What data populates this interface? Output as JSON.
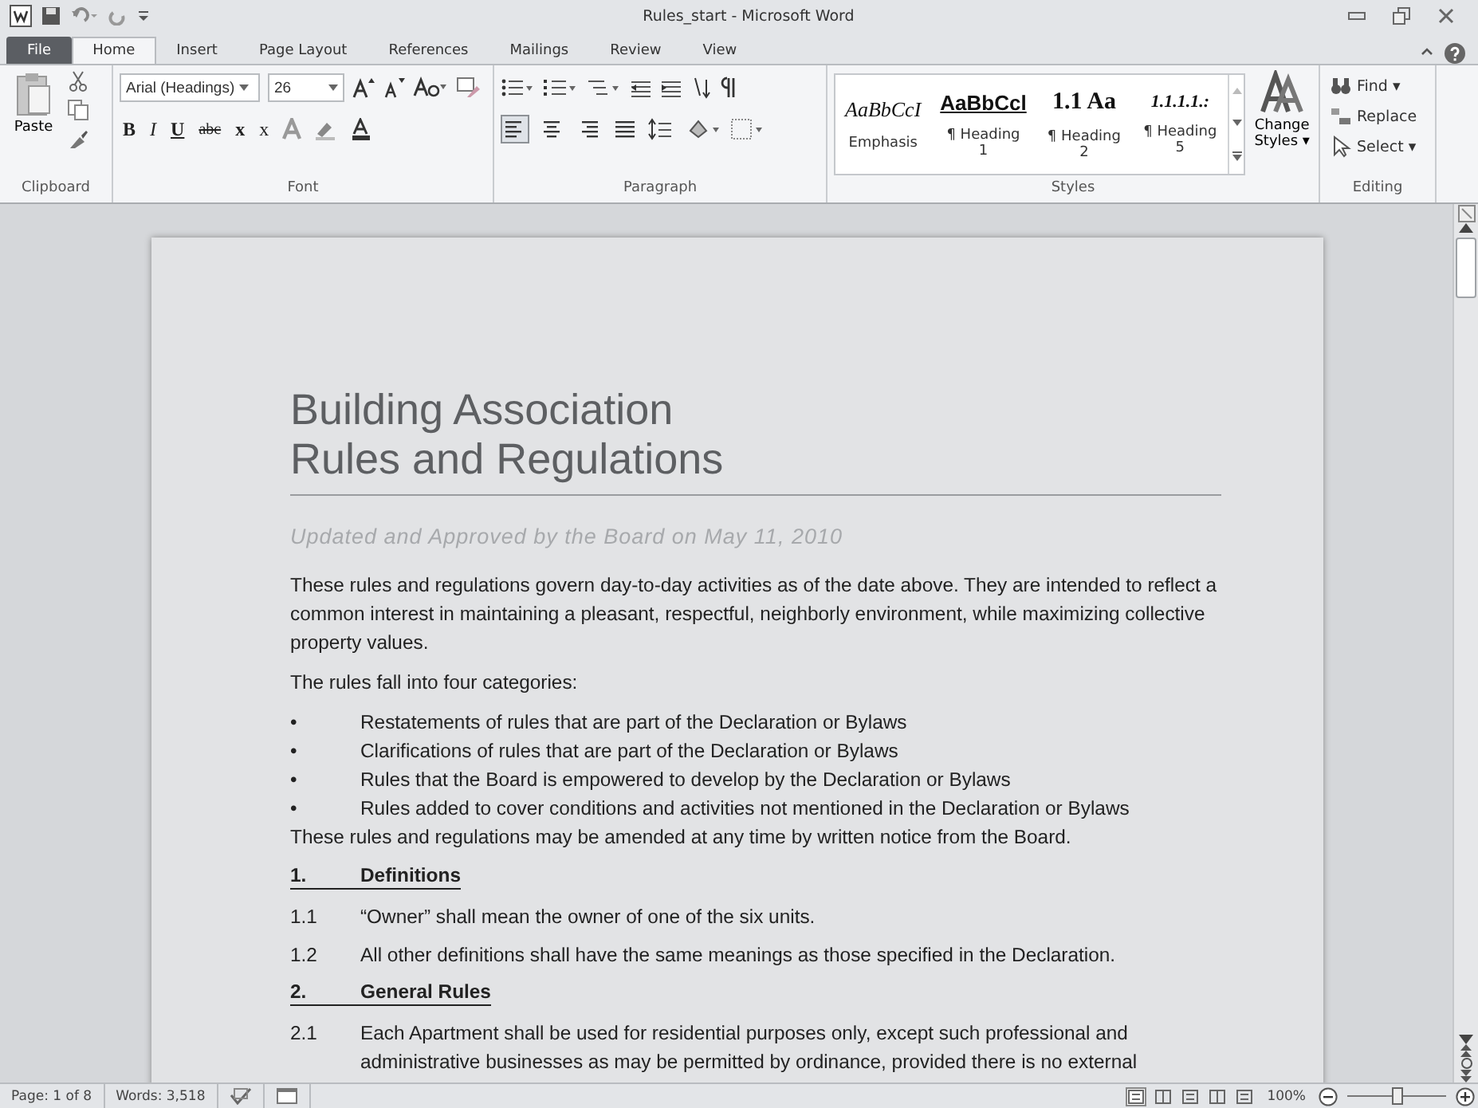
{
  "window": {
    "title": "Rules_start - Microsoft Word"
  },
  "tabs": [
    {
      "label": "File",
      "kind": "file",
      "selected": false
    },
    {
      "label": "Home",
      "kind": "tab",
      "selected": true
    },
    {
      "label": "Insert",
      "kind": "tab",
      "selected": false
    },
    {
      "label": "Page Layout",
      "kind": "tab",
      "selected": false
    },
    {
      "label": "References",
      "kind": "tab",
      "selected": false
    },
    {
      "label": "Mailings",
      "kind": "tab",
      "selected": false
    },
    {
      "label": "Review",
      "kind": "tab",
      "selected": false
    },
    {
      "label": "View",
      "kind": "tab",
      "selected": false
    }
  ],
  "ribbon": {
    "clipboard": {
      "label": "Clipboard",
      "paste": "Paste"
    },
    "font": {
      "label": "Font",
      "font_name": "Arial (Headings)",
      "font_size": "26",
      "buttons": [
        "B",
        "I",
        "U",
        "abc",
        "x",
        "x"
      ]
    },
    "paragraph": {
      "label": "Paragraph",
      "alignment": [
        {
          "selected": true
        },
        {
          "selected": false
        },
        {
          "selected": false
        },
        {
          "selected": false
        }
      ]
    },
    "styles": {
      "label": "Styles",
      "items": [
        {
          "preview": "AaBbCcI",
          "name": "Emphasis",
          "kind": "italic"
        },
        {
          "preview": "AaBbCcl",
          "name": "¶ Heading 1",
          "kind": "underlined"
        },
        {
          "preview": "1.1  Aa",
          "name": "¶ Heading 2",
          "kind": "bold"
        },
        {
          "preview": "1.1.1.1.:",
          "name": "¶ Heading 5",
          "kind": "bolditalic"
        }
      ],
      "change_styles": "Change Styles ▾"
    },
    "editing": {
      "label": "Editing",
      "items": [
        "Find ▾",
        "Replace",
        "Select ▾"
      ]
    }
  },
  "document": {
    "blocks": [
      {
        "kind": "title",
        "text": "Building Association"
      },
      {
        "kind": "title",
        "text": "Rules and Regulations"
      },
      {
        "kind": "rule"
      },
      {
        "kind": "subtitle",
        "text": "Updated and Approved by the Board on May 11, 2010"
      },
      {
        "kind": "para",
        "text": "These rules and regulations govern day-to-day activities as of the date above. They are intended to reflect a common interest in maintaining a pleasant, respectful, neighborly environment, while maximizing collective property values."
      },
      {
        "kind": "para",
        "text": "The rules fall into four categories:"
      },
      {
        "kind": "bullet",
        "marker": "•",
        "text": "Restatements of rules that are part of the Declaration or Bylaws"
      },
      {
        "kind": "bullet",
        "marker": "•",
        "text": "Clarifications of rules that are part of the Declaration or Bylaws"
      },
      {
        "kind": "bullet",
        "marker": "•",
        "text": "Rules that the Board is empowered to develop by the Declaration or Bylaws"
      },
      {
        "kind": "bullet",
        "marker": "•",
        "text": "Rules added to cover conditions and activities not mentioned in the Declaration or Bylaws"
      },
      {
        "kind": "para",
        "text": "These rules and regulations may be amended at any time by written notice from the Board."
      },
      {
        "kind": "section",
        "marker": "1.",
        "text": "Definitions"
      },
      {
        "kind": "numbered",
        "marker": "1.1",
        "text": "“Owner” shall mean the owner of one of the six units."
      },
      {
        "kind": "numbered",
        "marker": "1.2",
        "text": "All other definitions shall have the same meanings as those specified in the Declaration."
      },
      {
        "kind": "section",
        "marker": "2.",
        "text": "General Rules"
      },
      {
        "kind": "numbered",
        "marker": "2.1",
        "text": "Each Apartment shall be used for residential purposes only, except such professional and administrative businesses as may be permitted by ordinance, provided there is no external"
      }
    ]
  },
  "status_bar": {
    "page": "Page: 1 of 8",
    "words": "Words: 3,518",
    "views": [
      {
        "selected": true
      },
      {
        "selected": false
      },
      {
        "selected": false
      },
      {
        "selected": false
      },
      {
        "selected": false
      }
    ],
    "zoom": "100%",
    "zoom_slider": {
      "level": 0.5
    }
  }
}
